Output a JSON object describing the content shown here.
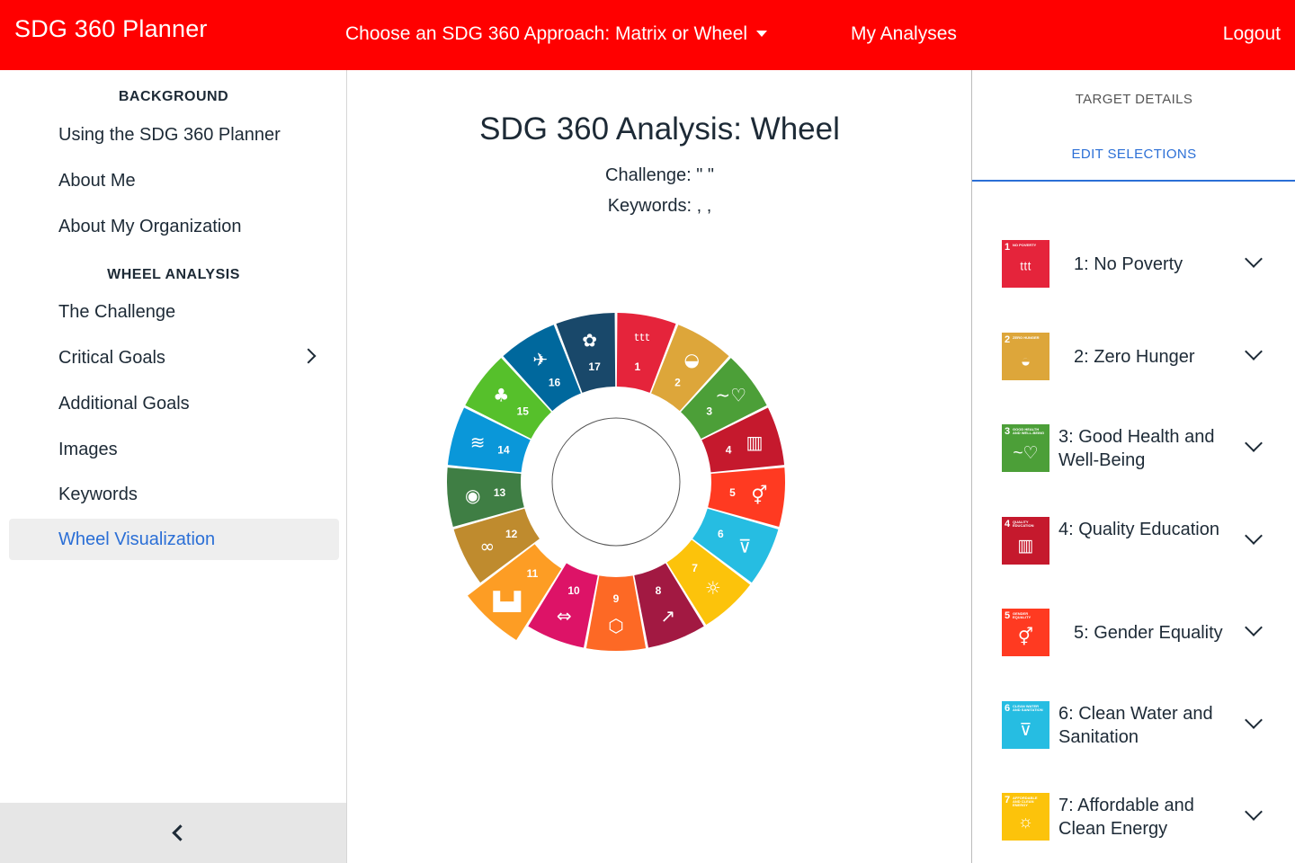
{
  "topbar": {
    "brand": "SDG 360 Planner",
    "approach": "Choose an SDG 360 Approach: Matrix or Wheel",
    "analyses": "My Analyses",
    "logout": "Logout",
    "color": "#ff0000"
  },
  "sidebar": {
    "background_title": "BACKGROUND",
    "background_items": [
      "Using the SDG 360 Planner",
      "About Me",
      "About My Organization"
    ],
    "wheel_title": "WHEEL ANALYSIS",
    "wheel_items": [
      "The Challenge",
      "Critical Goals",
      "Additional Goals",
      "Images",
      "Keywords",
      "Wheel Visualization"
    ],
    "active_item": "Wheel Visualization"
  },
  "main": {
    "title": "SDG 360 Analysis: Wheel",
    "challenge": "Challenge:  \" \"",
    "keywords": "Keywords: , ,"
  },
  "wheel": {
    "segments": [
      {
        "num": "1",
        "color": "#e5243b",
        "icon": "people-icon",
        "glyph": "ᵗᵗᵗ"
      },
      {
        "num": "2",
        "color": "#dda63a",
        "icon": "bowl-icon",
        "glyph": "◒"
      },
      {
        "num": "3",
        "color": "#4c9f38",
        "icon": "heartbeat-icon",
        "glyph": "~♡"
      },
      {
        "num": "4",
        "color": "#c5192d",
        "icon": "book-icon",
        "glyph": "▥"
      },
      {
        "num": "5",
        "color": "#ff3a21",
        "icon": "gender-icon",
        "glyph": "⚥"
      },
      {
        "num": "6",
        "color": "#26bde2",
        "icon": "water-icon",
        "glyph": "⊽"
      },
      {
        "num": "7",
        "color": "#fcc30b",
        "icon": "sun-power-icon",
        "glyph": "☼"
      },
      {
        "num": "8",
        "color": "#a21942",
        "icon": "growth-chart-icon",
        "glyph": "↗"
      },
      {
        "num": "9",
        "color": "#fd6925",
        "icon": "cubes-icon",
        "glyph": "⬡"
      },
      {
        "num": "10",
        "color": "#dd1367",
        "icon": "equal-arrows-icon",
        "glyph": "⇔"
      },
      {
        "num": "11",
        "color": "#fd9d24",
        "icon": "city-icon",
        "glyph": "▙▟"
      },
      {
        "num": "12",
        "color": "#bf8b2e",
        "icon": "infinity-icon",
        "glyph": "∞"
      },
      {
        "num": "13",
        "color": "#3f7e44",
        "icon": "eye-earth-icon",
        "glyph": "◉"
      },
      {
        "num": "14",
        "color": "#0a97d9",
        "icon": "fish-icon",
        "glyph": "≋"
      },
      {
        "num": "15",
        "color": "#56c02b",
        "icon": "tree-icon",
        "glyph": "♣"
      },
      {
        "num": "16",
        "color": "#00689d",
        "icon": "dove-icon",
        "glyph": "✈"
      },
      {
        "num": "17",
        "color": "#19486a",
        "icon": "flower-rings-icon",
        "glyph": "✿"
      }
    ],
    "highlighted": "11"
  },
  "rightpanel": {
    "tab_details": "TARGET DETAILS",
    "tab_edit": "EDIT SELECTIONS",
    "goals": [
      {
        "num": "1",
        "title": "1: No Poverty",
        "mini": "NO POVERTY",
        "color": "#e5243b",
        "icon": "people-icon",
        "glyph": "ᵗᵗᵗ"
      },
      {
        "num": "2",
        "title": "2: Zero Hunger",
        "mini": "ZERO HUNGER",
        "color": "#dda63a",
        "icon": "bowl-icon",
        "glyph": "◒"
      },
      {
        "num": "3",
        "title": "3: Good Health and Well-Being",
        "mini": "GOOD HEALTH AND WELL-BEING",
        "color": "#4c9f38",
        "icon": "heartbeat-icon",
        "glyph": "~♡"
      },
      {
        "num": "4",
        "title": "4: Quality Education",
        "mini": "QUALITY EDUCATION",
        "color": "#c5192d",
        "icon": "book-icon",
        "glyph": "▥"
      },
      {
        "num": "5",
        "title": "5: Gender Equality",
        "mini": "GENDER EQUALITY",
        "color": "#ff3a21",
        "icon": "gender-icon",
        "glyph": "⚥"
      },
      {
        "num": "6",
        "title": "6: Clean Water and Sanitation",
        "mini": "CLEAN WATER AND SANITATION",
        "color": "#26bde2",
        "icon": "water-icon",
        "glyph": "⊽"
      },
      {
        "num": "7",
        "title": "7: Affordable and Clean Energy",
        "mini": "AFFORDABLE AND CLEAN ENERGY",
        "color": "#fcc30b",
        "icon": "sun-power-icon",
        "glyph": "☼"
      }
    ]
  }
}
